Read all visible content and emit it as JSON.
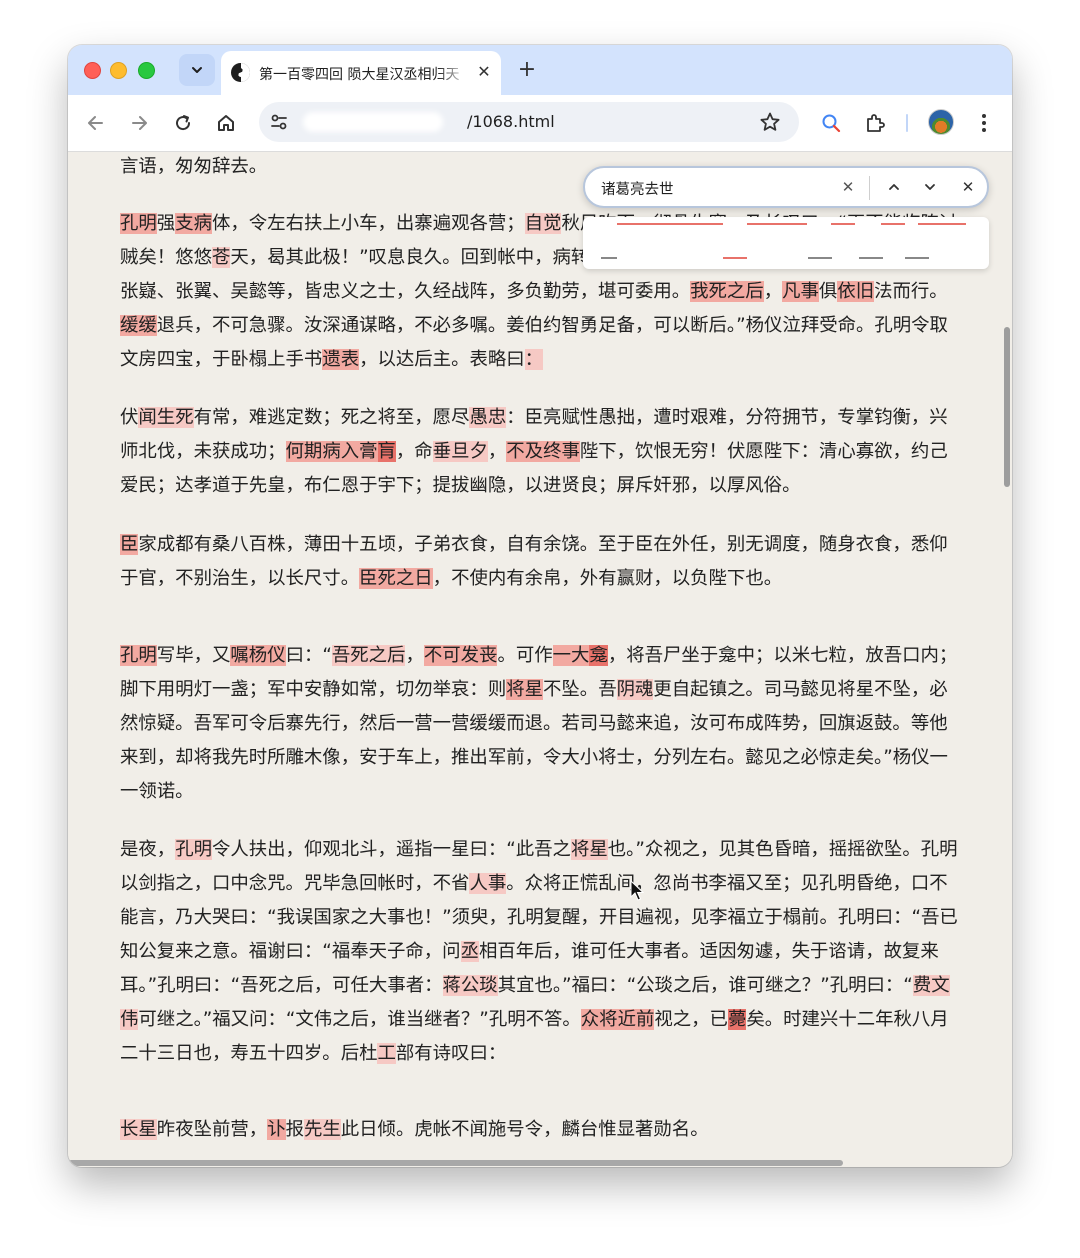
{
  "browser": {
    "tab_title": "第一百零四回 陨大星汉丞相归天",
    "url_prefix": "",
    "url_suffix": "/1068.html",
    "new_tab": "+",
    "tab_close": "✕"
  },
  "find": {
    "query": "诸葛亮去世",
    "clear": "✕",
    "close": "✕"
  },
  "article": {
    "p0": "言语，匆匆辞去。",
    "p1": [
      {
        "t": "孔明",
        "m": "s"
      },
      {
        "t": "强"
      },
      {
        "t": "支病",
        "m": "s"
      },
      {
        "t": "体，令左右扶上小车，出寨遍观各营；"
      },
      {
        "t": "自觉",
        "m": "l"
      },
      {
        "t": "秋风吹面，彻骨生寒，乃长叹曰：“再不能"
      },
      {
        "t": "临阵讨贼矣！悠悠"
      },
      {
        "t": "苍",
        "m": "l"
      },
      {
        "t": "天，曷其此极！”叹息良久。回到帐中，病转沉重，乃唤姜维、杨仪、费祎、王"
      },
      {
        "t": "平、廖化、张嶷、张翼、吴懿等，皆忠义之士，久经战阵，多负勤劳，堪可委用。"
      },
      {
        "t": "我死之后",
        "m": "s"
      },
      {
        "t": "，"
      },
      {
        "t": "凡事",
        "m": "s"
      },
      {
        "t": "俱"
      },
      {
        "t": "依旧",
        "m": "s"
      },
      {
        "t": "法而行。"
      },
      {
        "t": "缓缓",
        "m": "s"
      },
      {
        "t": "退兵，不可急骤。汝深通谋略，不必多嘱。姜伯约智勇足备，可以断后。”杨"
      },
      {
        "t": "仪泣拜受命。孔明令取文房四宝，于卧榻上手书"
      },
      {
        "t": "遗表",
        "m": "s"
      },
      {
        "t": "，以达后主。表略曰"
      },
      {
        "t": "：",
        "m": "l"
      }
    ],
    "p2": [
      {
        "t": "伏"
      },
      {
        "t": "闻生死",
        "m": "l"
      },
      {
        "t": "有常，难逃定数；死之将至，愿尽"
      },
      {
        "t": "愚忠",
        "m": "l"
      },
      {
        "t": "：臣亮赋性愚拙，遭时艰难，分符拥节，专掌钧"
      },
      {
        "t": "衡，兴师北伐，未获成功；"
      },
      {
        "t": "何期病入膏",
        "m": "s"
      },
      {
        "t": "肓",
        "m": "d"
      },
      {
        "t": "，命"
      },
      {
        "t": "垂旦夕",
        "m": "l"
      },
      {
        "t": "，"
      },
      {
        "t": "不及终事",
        "m": "s"
      },
      {
        "t": "陛下，饮恨无穷！伏愿陛下：清心"
      },
      {
        "t": "寡欲，约己爱民；达孝道于先皇，布仁恩于宇下；提拔幽隐，以进贤良；屏斥奸邪，以厚风俗。"
      }
    ],
    "p3": [
      {
        "t": "臣",
        "m": "s"
      },
      {
        "t": "家成都有桑八百株，薄田十五顷，子弟衣食，自有余饶。至于臣在外任，别无调度，随身衣食，"
      },
      {
        "t": "悉仰于官，不别治生，以长尺寸。"
      },
      {
        "t": "臣死之日",
        "m": "s"
      },
      {
        "t": "，不使内有余帛，外有赢财，以负陛下也。"
      }
    ],
    "p4": [
      {
        "t": "孔明",
        "m": "s"
      },
      {
        "t": "写毕，又"
      },
      {
        "t": "嘱杨仪",
        "m": "s"
      },
      {
        "t": "曰：“"
      },
      {
        "t": "吾死之后",
        "m": "l"
      },
      {
        "t": "，"
      },
      {
        "t": "不可发丧",
        "m": "s"
      },
      {
        "t": "。可作"
      },
      {
        "t": "一大",
        "m": "s"
      },
      {
        "t": "龛",
        "m": "d"
      },
      {
        "t": "，将吾尸坐于龛中；以米七粒，放吾"
      },
      {
        "t": "口内；脚下用明灯一盏；军中安静如常，切勿举哀：则"
      },
      {
        "t": "将星",
        "m": "s"
      },
      {
        "t": "不坠。吾"
      },
      {
        "t": "阴魂",
        "m": "l"
      },
      {
        "t": "更自起镇之。司马懿见将"
      },
      {
        "t": "星不坠，必然惊疑。吾军可令后寨先行，然后一营一营缓缓而退。若司马懿来追，汝可布成阵势，"
      },
      {
        "t": "回旗返鼓。等他来到，却将我先时所雕木像，安于车上，推出军前，令大小将士，分列左右。懿见"
      },
      {
        "t": "之必惊走矣。”杨仪一一领诺。"
      }
    ],
    "p5": [
      {
        "t": "是夜，"
      },
      {
        "t": "孔明",
        "m": "l"
      },
      {
        "t": "令人扶出，仰观北斗，遥指一星曰：“此吾之"
      },
      {
        "t": "将星",
        "m": "l"
      },
      {
        "t": "也。”众视之，见其色昏暗，摇摇欲"
      },
      {
        "t": "坠。孔明以剑指之，口中念咒。咒毕急回帐时，不省"
      },
      {
        "t": "人事",
        "m": "l"
      },
      {
        "t": "。众将正慌乱间，忽尚书李福又至；见孔"
      },
      {
        "t": "明昏绝，口不能言，乃大哭曰：“我误国家之大事也！”须臾，孔明复醒，开目遍视，见李福立于"
      },
      {
        "t": "榻前。孔明曰：“吾已知公复来之意。福谢曰：“福奉天子命，问"
      },
      {
        "t": "丞",
        "m": "l"
      },
      {
        "t": "相百年后，谁可任大事者。适"
      },
      {
        "t": "因匆遽，失于谘请，故复来耳。”孔明曰：“吾死之后，可任大事者："
      },
      {
        "t": "蒋公琰",
        "m": "l"
      },
      {
        "t": "其宜也。”福曰：“公琰"
      },
      {
        "t": "之后，谁可继之？”孔明曰：“"
      },
      {
        "t": "费文伟",
        "m": "l"
      },
      {
        "t": "可继之。”福又问：“文伟之后，谁当继者？”孔明不答。"
      },
      {
        "t": "众将",
        "m": "s"
      },
      {
        "t": "近前",
        "m": "s"
      },
      {
        "t": "视之，已"
      },
      {
        "t": "薨",
        "m": "d"
      },
      {
        "t": "矣。时建兴十二年秋八月二十三日也，寿五十四岁。后杜"
      },
      {
        "t": "工",
        "m": "l"
      },
      {
        "t": "部有诗叹曰："
      }
    ],
    "p6": [
      {
        "t": "长星",
        "m": "l"
      },
      {
        "t": "昨夜坠前营，"
      },
      {
        "t": "讣",
        "m": "s"
      },
      {
        "t": "报"
      },
      {
        "t": "先生",
        "m": "l"
      },
      {
        "t": "此日倾。虎帐不闻施号令，麟台惟显著勋名。"
      }
    ]
  },
  "icons": {
    "back": "arrow-left-icon",
    "forward": "arrow-right-icon",
    "reload": "reload-icon",
    "home": "home-icon",
    "site_info": "tune-icon",
    "bookmark": "star-icon",
    "search": "search-icon",
    "extensions": "puzzle-icon",
    "menu": "kebab-menu-icon"
  },
  "colors": {
    "match_light": "#f6c9c4",
    "match_strong": "#f2a9a1",
    "match_dark": "#e8726a",
    "tabstrip": "#d3e3fd",
    "page_bg": "#f1eee8"
  }
}
